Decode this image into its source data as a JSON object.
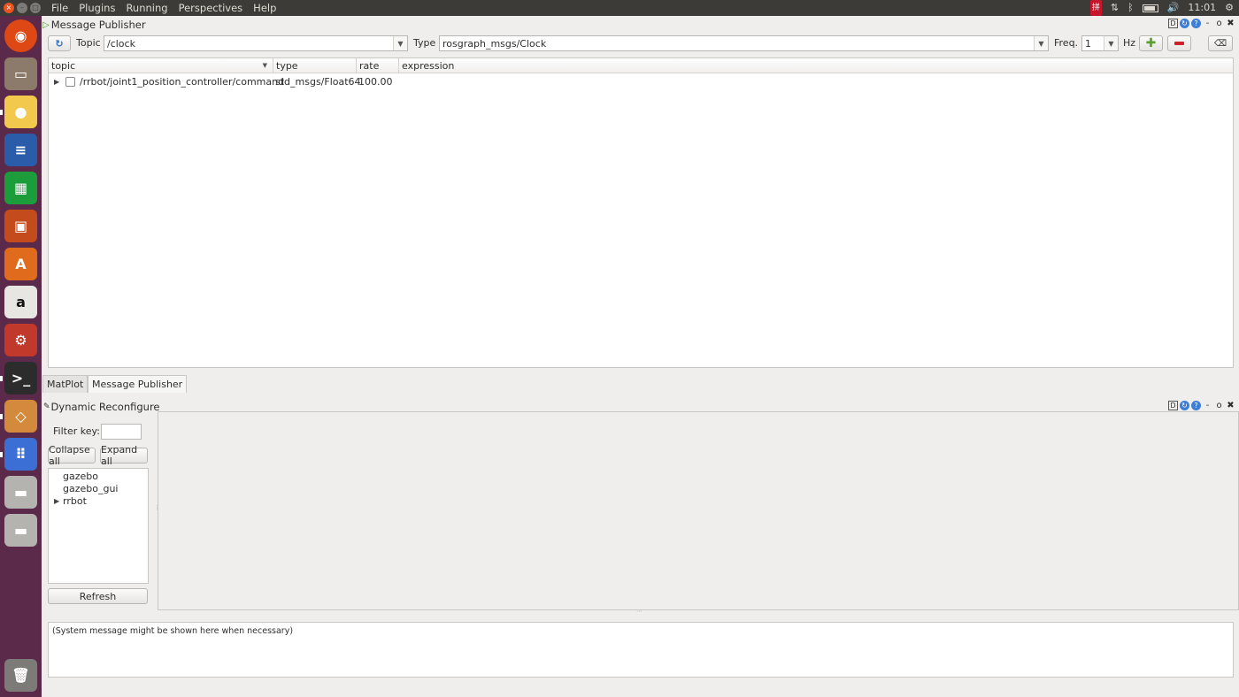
{
  "topbar": {
    "menus": [
      "File",
      "Plugins",
      "Running",
      "Perspectives",
      "Help"
    ],
    "clock": "11:01"
  },
  "launcher": {
    "items": [
      {
        "name": "ubuntu-dash",
        "color": "#dd4814",
        "glyph": "◉"
      },
      {
        "name": "files",
        "color": "#8c7a6b",
        "glyph": "▭"
      },
      {
        "name": "chrome",
        "color": "#f2c94c",
        "glyph": "●"
      },
      {
        "name": "writer",
        "color": "#2a5caa",
        "glyph": "≡"
      },
      {
        "name": "calc",
        "color": "#1c9c3a",
        "glyph": "▦"
      },
      {
        "name": "impress",
        "color": "#c44b1b",
        "glyph": "▣"
      },
      {
        "name": "software-center",
        "color": "#e06b1c",
        "glyph": "A"
      },
      {
        "name": "amazon",
        "color": "#e8e6e3",
        "glyph": "a"
      },
      {
        "name": "settings",
        "color": "#c0392b",
        "glyph": "⚙"
      },
      {
        "name": "terminal",
        "color": "#2c2c2c",
        "glyph": ">_"
      },
      {
        "name": "gazebo",
        "color": "#d48a3c",
        "glyph": "◇"
      },
      {
        "name": "app-grid",
        "color": "#3b6fd6",
        "glyph": "⠿"
      },
      {
        "name": "drive-1",
        "color": "#b5b3af",
        "glyph": "▬"
      },
      {
        "name": "drive-2",
        "color": "#b5b3af",
        "glyph": "▬"
      },
      {
        "name": "trash",
        "color": "#7d7b78",
        "glyph": "🗑"
      }
    ]
  },
  "publisher": {
    "title": "Message Publisher",
    "topic_label": "Topic",
    "topic_value": "/clock",
    "type_label": "Type",
    "type_value": "rosgraph_msgs/Clock",
    "freq_label": "Freq.",
    "freq_value": "1",
    "hz_label": "Hz",
    "columns": [
      "topic",
      "type",
      "rate",
      "expression"
    ],
    "rows": [
      {
        "topic": "/rrbot/joint1_position_controller/command",
        "type": "std_msgs/Float64",
        "rate": "100.00",
        "expression": ""
      }
    ]
  },
  "tabs": [
    "MatPlot",
    "Message Publisher"
  ],
  "dynamic": {
    "title": "Dynamic Reconfigure",
    "filter_label": "Filter key:",
    "filter_value": "",
    "collapse_label": "Collapse all",
    "expand_label": "Expand all",
    "tree": [
      "gazebo",
      "gazebo_gui",
      "rrbot"
    ],
    "refresh_label": "Refresh"
  },
  "system_message": "(System message might be shown here when necessary)"
}
